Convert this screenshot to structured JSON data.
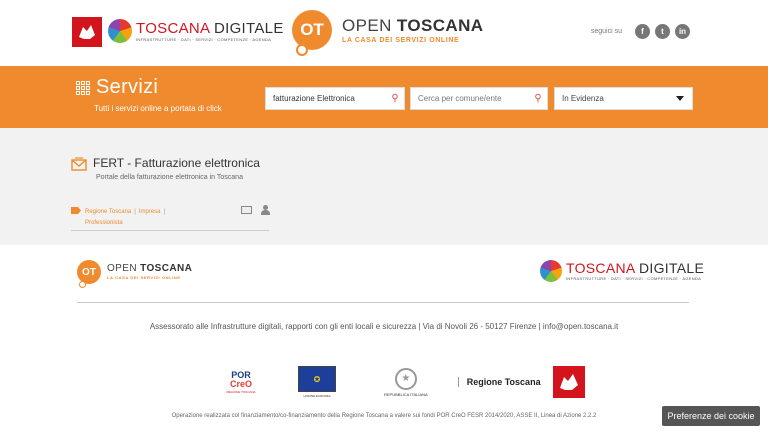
{
  "header": {
    "toscana_digitale": {
      "word1": "TOSCANA",
      "word2": "DIGITALE",
      "subtitle": "INFRASTRUTTURE · DATI · SERVIZI · COMPETENZE · AGENDA"
    },
    "open_toscana": {
      "badge": "OT",
      "word1": "OPEN",
      "word2": "TOSCANA",
      "subtitle": "LA CASA DEI SERVIZI ONLINE"
    },
    "social": {
      "label": "seguici su",
      "facebook": "f",
      "twitter": "t",
      "linkedin": "in"
    }
  },
  "band": {
    "title": "Servizi",
    "subtitle": "Tutti i servizi online a portata di click",
    "search_value": "fatturazione Elettronica",
    "city_placeholder": "Cerca per comune/ente",
    "filter_selected": "In Evidenza"
  },
  "card": {
    "title": "FERT - Fatturazione elettronica",
    "description": "Portale della fatturazione elettronica in Toscana",
    "tags": [
      "Regione Toscana",
      "Impresa",
      "Professionista"
    ]
  },
  "footer": {
    "address": "Assessorato alle Infrastrutture digitali, rapporti con gli enti locali e sicurezza | Via di Novoli 26 - 50127 Firenze | info@open.toscana.it",
    "porcreo": {
      "line1": "POR",
      "line2": "CreO",
      "sub": "REGIONE TOSCANA"
    },
    "eu_label": "UNIONE EUROPEA",
    "ri_label": "REPUBBLICA ITALIANA",
    "regione_label": "Regione Toscana",
    "credits": "Operazione realizzata col finanziamento/co-finanziamento della Regione Toscana a valere sui fondi POR CreO FESR 2014/2020, ASSE II, Linea di Azione 2.2.2",
    "cookie_button": "Preferenze dei cookie"
  },
  "colors": {
    "accent": "#ef8a2e",
    "brand_red": "#d4141c"
  }
}
